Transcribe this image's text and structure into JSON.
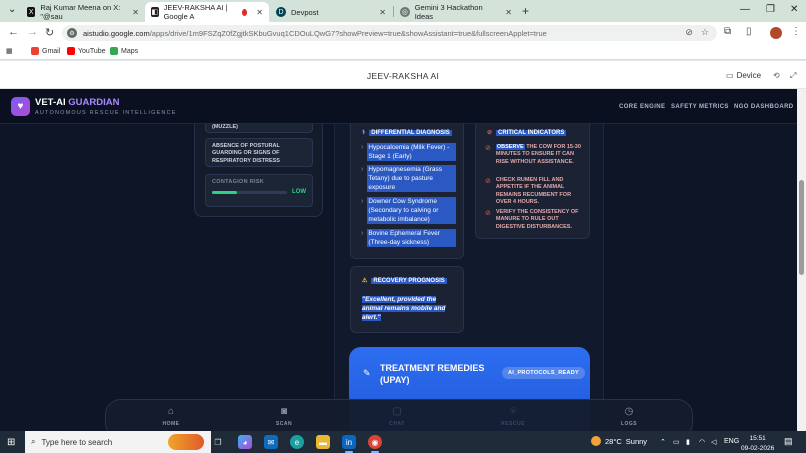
{
  "browser": {
    "tabs": [
      {
        "label": "Raj Kumar Meena on X: \"@sau",
        "icon": "x-logo-icon"
      },
      {
        "label": "JEEV-RAKSHA AI | Google A",
        "icon": "ai-studio-icon",
        "active": true
      },
      {
        "label": "Devpost",
        "icon": "devpost-icon"
      },
      {
        "label": "Gemini 3 Hackathon Ideas",
        "icon": "gemini-icon"
      }
    ],
    "new_tab": "+",
    "url_host": "aistudio.google.com",
    "url_rest": "/apps/drive/1m9FSZqZ0fZgjtkSKbuGvuq1CDOuLQwG7?showPreview=true&showAssistant=true&fullscreenApplet=true",
    "bookmarks": [
      "Gmail",
      "YouTube",
      "Maps"
    ]
  },
  "studio": {
    "title": "JEEV-RAKSHA AI",
    "device_label": "Device"
  },
  "app": {
    "brand_main": "VET-AI",
    "brand_accent": "GUARDIAN",
    "tagline": "AUTONOMOUS RESCUE INTELLIGENCE",
    "nav": [
      "CORE ENGINE",
      "SAFETY METRICS",
      "NGO DASHBOARD"
    ],
    "left": {
      "muzzle": "(MUZZLE)",
      "absence": "ABSENCE OF POSTURAL GUARDING OR SIGNS OF RESPIRATORY DISTRESS",
      "contagion_label": "CONTAGION RISK",
      "contagion_level": "LOW",
      "contagion_fraction": 0.33
    },
    "diagnosis": {
      "title": "DIFFERENTIAL DIAGNOSIS",
      "items": [
        "Hypocalcemia (Milk Fever) - Stage 1 (Early)",
        "Hypomagnesemia (Grass Tetany) due to pasture exposure",
        "Downer Cow Syndrome (Secondary to calving or metabolic imbalance)",
        "Bovine Ephemeral Fever (Three-day sickness)"
      ]
    },
    "critical": {
      "title": "CRITICAL INDICATORS",
      "items": [
        {
          "bold": "OBSERVE",
          "rest": " THE COW FOR 15-30 MINUTES TO ENSURE IT CAN RISE WITHOUT ASSISTANCE."
        },
        {
          "bold": "",
          "rest": "CHECK RUMEN FILL AND APPETITE IF THE ANIMAL REMAINS RECUMBENT FOR OVER 4 HOURS."
        },
        {
          "bold": "",
          "rest": "VERIFY THE CONSISTENCY OF MANURE TO RULE OUT DIGESTIVE DISTURBANCES."
        }
      ]
    },
    "prognosis": {
      "title": "RECOVERY PROGNOSIS",
      "quote": "\"Excellent, provided the animal remains mobile and alert.\""
    },
    "treatment": {
      "title": "TREATMENT REMEDIES (UPAY)",
      "badge": "AI_PROTOCOLS_READY"
    },
    "bottom_nav": [
      "HOME",
      "SCAN",
      "CHAT",
      "RESCUE",
      "LOGS"
    ]
  },
  "taskbar": {
    "search_placeholder": "Type here to search",
    "temperature": "28°C",
    "weather": "Sunny",
    "language": "ENG",
    "time": "15:51",
    "date": "09-02-2026"
  }
}
